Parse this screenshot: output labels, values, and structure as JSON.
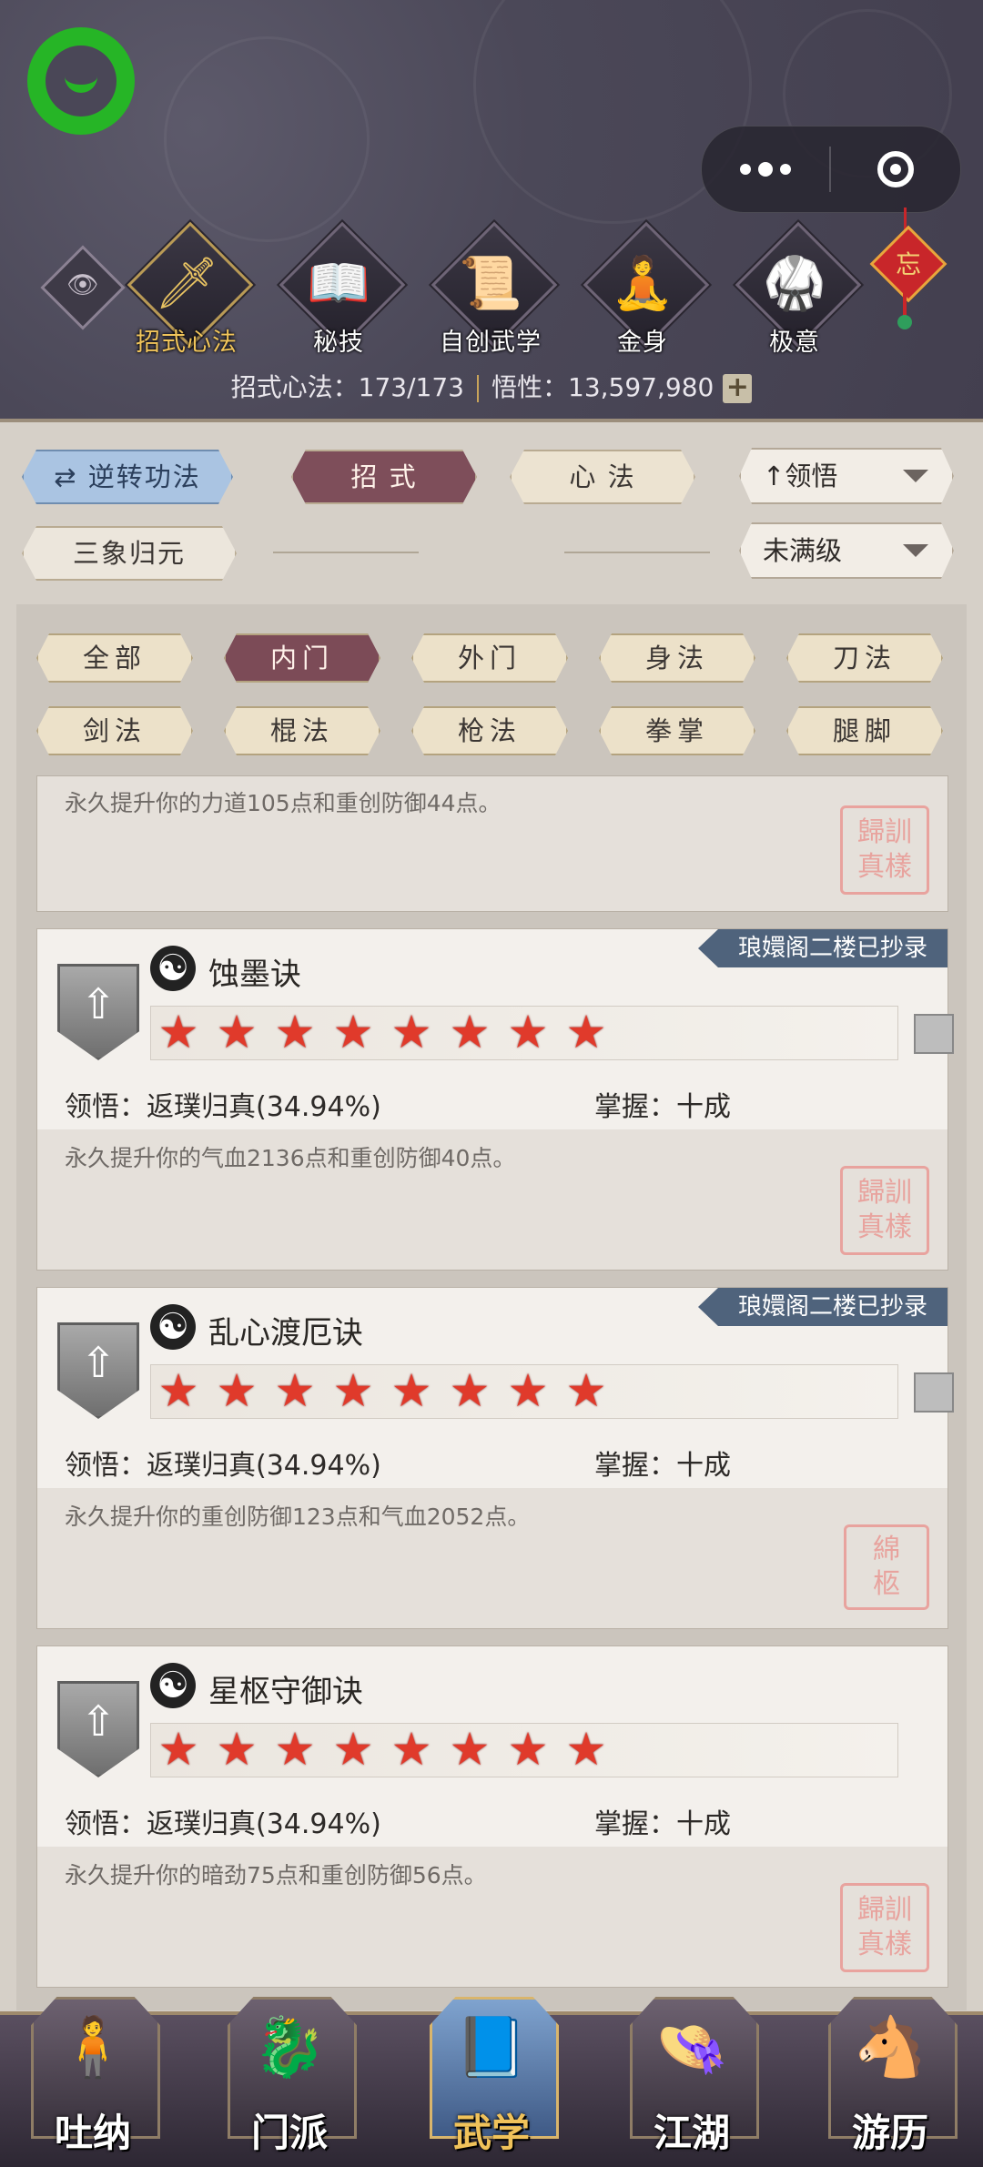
{
  "header": {
    "nav_tiles": [
      {
        "label": "招式心法",
        "icon": "sword-icon",
        "glyph": "🗡"
      },
      {
        "label": "秘技",
        "icon": "book-icon",
        "glyph": "📖"
      },
      {
        "label": "自创武学",
        "icon": "scroll-icon",
        "glyph": "📜"
      },
      {
        "label": "金身",
        "icon": "meditation-icon",
        "glyph": "🧘"
      },
      {
        "label": "极意",
        "icon": "fighter-icon",
        "glyph": "🥋"
      }
    ],
    "charm_char": "忘",
    "stats": {
      "moves_label": "招式心法：173/173",
      "insight_label": "悟性：13,597,980",
      "plus": "+"
    }
  },
  "toolbar": {
    "reverse_label": "逆转功法",
    "moves_tab": "招 式",
    "mind_tab": "心 法",
    "sort_label": "领悟",
    "sort_arrow": "↑",
    "sanxiang_label": "三象归元",
    "level_filter": "未满级"
  },
  "filters": {
    "row1": [
      "全部",
      "内门",
      "外门",
      "身法",
      "刀法"
    ],
    "row2": [
      "剑法",
      "棍法",
      "枪法",
      "拳掌",
      "腿脚"
    ]
  },
  "cards": [
    {
      "desc": "永久提升你的力道105点和重创防御44点。",
      "seal": "歸訓真樣"
    },
    {
      "name": "蚀墨诀",
      "ribbon": "琅嬛阁二楼已抄录",
      "stars": 8,
      "insight_label": "领悟：",
      "insight_value": "返璞归真(34.94%)",
      "mastery_label": "掌握：",
      "mastery_value": "十成",
      "desc": "永久提升你的气血2136点和重创防御40点。",
      "seal": "歸訓真樣"
    },
    {
      "name": "乱心渡厄诀",
      "ribbon": "琅嬛阁二楼已抄录",
      "stars": 8,
      "insight_label": "领悟：",
      "insight_value": "返璞归真(34.94%)",
      "mastery_label": "掌握：",
      "mastery_value": "十成",
      "desc": "永久提升你的重创防御123点和气血2052点。",
      "seal": "綿柩"
    },
    {
      "name": "星枢守御诀",
      "stars": 8,
      "insight_label": "领悟：",
      "insight_value": "返璞归真(34.94%)",
      "mastery_label": "掌握：",
      "mastery_value": "十成",
      "desc": "永久提升你的暗劲75点和重创防御56点。",
      "seal": "歸訓真樣"
    }
  ],
  "bottom_nav": [
    {
      "label": "吐纳",
      "icon": "monk-icon"
    },
    {
      "label": "门派",
      "icon": "sect-icon"
    },
    {
      "label": "武学",
      "icon": "martial-book-icon"
    },
    {
      "label": "江湖",
      "icon": "straw-hat-icon"
    },
    {
      "label": "游历",
      "icon": "horse-icon"
    }
  ],
  "colors": {
    "header_bg": "#4a4757",
    "active_gold": "#f1c55b",
    "tag_active": "#7c4b57",
    "ribbon": "#4f637c",
    "star_red": "#e03a2b"
  }
}
